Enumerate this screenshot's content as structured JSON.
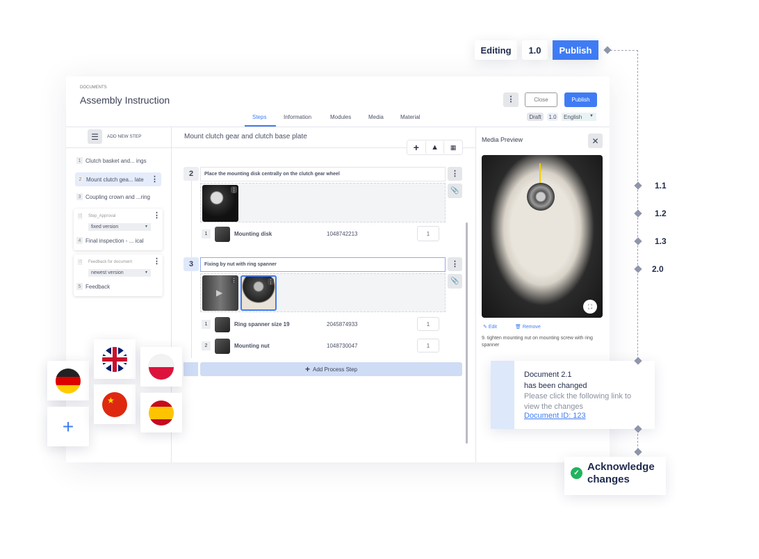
{
  "version_bar": {
    "editing": "Editing",
    "version": "1.0",
    "publish": "Publish"
  },
  "version_history": [
    "1.1",
    "1.2",
    "1.3",
    "2.0"
  ],
  "header": {
    "breadcrumb": "DOCUMENTS",
    "title": "Assembly Instruction",
    "close": "Close",
    "publish": "Publish",
    "status": "Draft",
    "version": "1.0",
    "language": "English"
  },
  "tabs": [
    "Steps",
    "Information",
    "Modules",
    "Media",
    "Material"
  ],
  "sidebar": {
    "add_step": "ADD NEW STEP",
    "items": [
      {
        "num": "1",
        "label": "Clutch basket and... ings"
      },
      {
        "num": "2",
        "label": "Mount clutch gea... late"
      },
      {
        "num": "3",
        "label": "Coupling crown and ...ring"
      }
    ],
    "approval": {
      "title": "Step_Approval",
      "select": "fixed version",
      "num": "4",
      "label": "Final inspection - ... ical"
    },
    "feedback": {
      "title": "Feedback for document",
      "select": "newest version",
      "num": "5",
      "label": "Feedback"
    }
  },
  "main": {
    "title": "Mount clutch gear and clutch base plate",
    "steps": [
      {
        "num": "2",
        "text": "Place the mounting disk centrally on the clutch gear wheel",
        "materials": [
          {
            "pos": "1",
            "name": "Mounting disk",
            "id": "1048742213",
            "qty": "1"
          }
        ]
      },
      {
        "num": "3",
        "text": "Fixing by nut with ring spanner",
        "materials": [
          {
            "pos": "1",
            "name": "Ring spanner size 19",
            "id": "2045874933",
            "qty": "1"
          },
          {
            "pos": "2",
            "name": "Mounting nut",
            "id": "1048730047",
            "qty": "1"
          }
        ]
      }
    ],
    "add_process_step": "Add Process Step"
  },
  "media_preview": {
    "title": "Media Preview",
    "edit": "Edit",
    "remove": "Remove",
    "caption": "9. tighten mounting nut on mounting screw with ring spanner"
  },
  "notification": {
    "title1": "Document 2.1",
    "title2": "has been changed",
    "body": "Please click the following link to view the changes",
    "link": "Document ID: 123"
  },
  "acknowledge": {
    "label1": "Acknowledge",
    "label2": "changes"
  },
  "languages": [
    "German",
    "English (UK)",
    "Polish",
    "Chinese",
    "Spanish"
  ],
  "colors": {
    "accent": "#3f7cf4",
    "navy": "#1f2a4d",
    "success": "#22b35e",
    "highlight": "#dde8fb"
  }
}
